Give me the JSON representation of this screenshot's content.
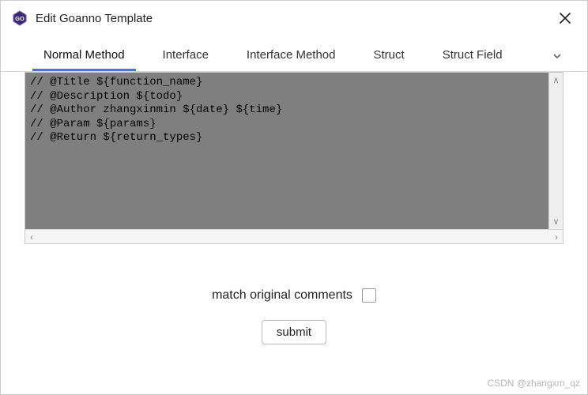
{
  "window": {
    "title": "Edit Goanno Template"
  },
  "tabs": [
    {
      "label": "Normal Method",
      "active": true
    },
    {
      "label": "Interface",
      "active": false
    },
    {
      "label": "Interface Method",
      "active": false
    },
    {
      "label": "Struct",
      "active": false
    },
    {
      "label": "Struct Field",
      "active": false
    }
  ],
  "editor": {
    "lines": [
      "// @Title ${function_name}",
      "// @Description ${todo}",
      "// @Author zhangxinmin ${date} ${time}",
      "// @Param ${params}",
      "// @Return ${return_types}"
    ]
  },
  "checkbox": {
    "label": "match original comments",
    "checked": false
  },
  "buttons": {
    "submit": "submit"
  },
  "watermark": "CSDN @zhangxm_qz"
}
